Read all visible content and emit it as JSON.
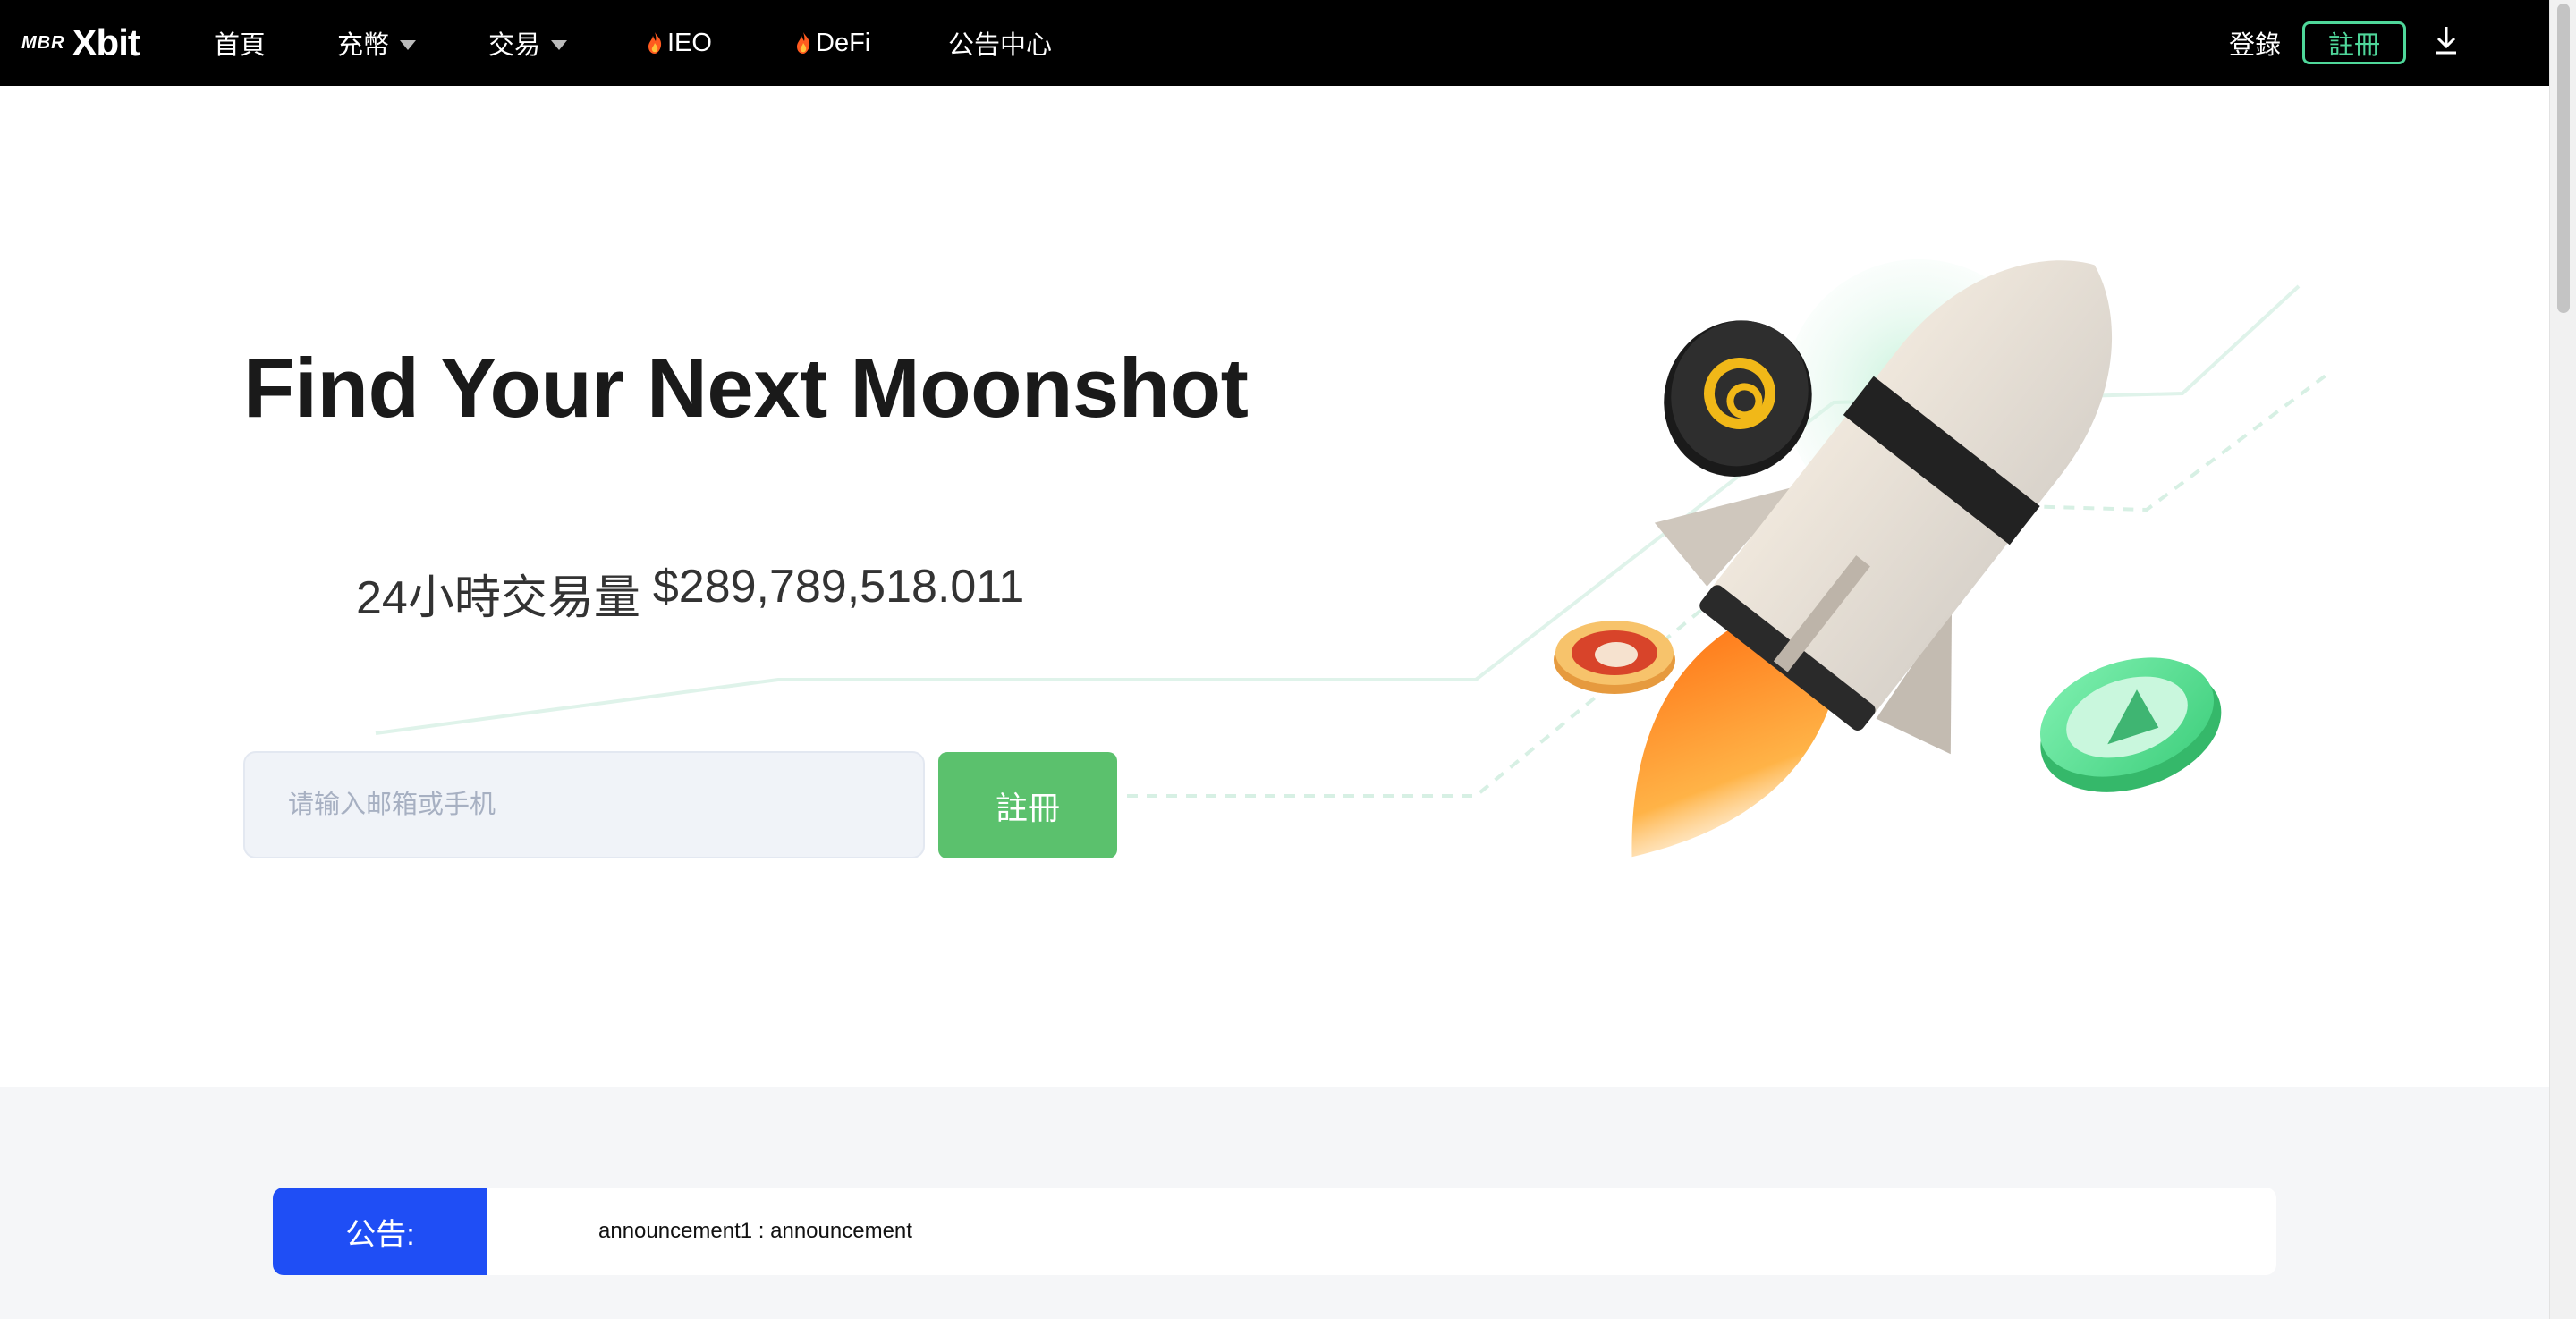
{
  "nav": {
    "logo_small": "MBR",
    "logo_big": "Xbit",
    "items": [
      {
        "label": "首頁"
      },
      {
        "label": "充幣"
      },
      {
        "label": "交易"
      },
      {
        "label": "IEO"
      },
      {
        "label": "DeFi"
      },
      {
        "label": "公告中心"
      }
    ],
    "login": "登錄",
    "register": "註冊"
  },
  "hero": {
    "title": "Find Your Next Moonshot",
    "volume_label": "24小時交易量",
    "volume_value": "$289,789,518.011",
    "input_placeholder": "请输入邮箱或手机",
    "register_button": "註冊"
  },
  "announcement": {
    "label": "公告:",
    "text": "announcement1 : announcement"
  },
  "colors": {
    "nav_bg": "#000000",
    "accent_green": "#4fd79a",
    "button_green": "#5bc16d",
    "announce_blue": "#1f4ef5"
  }
}
